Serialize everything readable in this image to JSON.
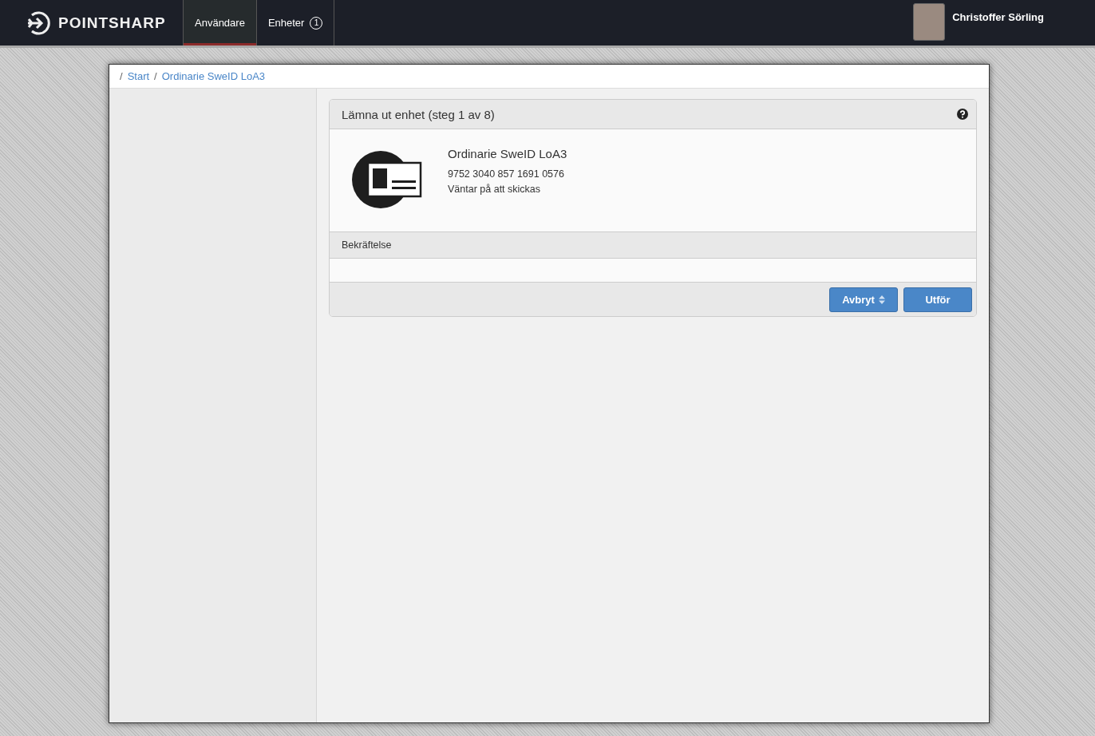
{
  "header": {
    "logo": "POINTSHARP",
    "tabs": [
      {
        "label": "Användare",
        "selected": true
      },
      {
        "label": "Enheter",
        "badge": "1",
        "selected": false
      }
    ],
    "user": {
      "name": "Christoffer Sörling"
    }
  },
  "breadcrumb": [
    {
      "separator": "/",
      "label": "Start"
    },
    {
      "separator": "/",
      "label": "Ordinarie SweID LoA3"
    }
  ],
  "panel": {
    "title": "Lämna ut enhet (steg 1 av 8)",
    "device": {
      "name": "Ordinarie SweID LoA3",
      "number": "9752 3040 857 1691 0576",
      "status": "Väntar på att skickas"
    },
    "section": "Bekräftelse",
    "buttons": [
      {
        "label": "Avbryt",
        "kind": "dropdown"
      },
      {
        "label": "Utför",
        "kind": "plain"
      }
    ]
  }
}
